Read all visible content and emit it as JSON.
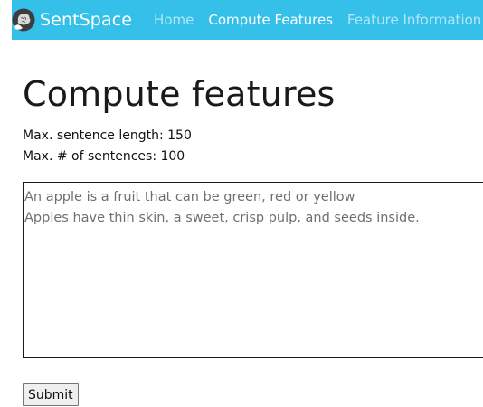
{
  "app": {
    "brand_name": "SentSpace",
    "brand_logo_icon": "brain-icon"
  },
  "navbar": {
    "background_color": "#35c0ea",
    "links": [
      {
        "label": "Home",
        "state": "inactive"
      },
      {
        "label": "Compute Features",
        "state": "active"
      },
      {
        "label": "Feature Information",
        "state": "inactive"
      }
    ]
  },
  "main": {
    "title": "Compute features",
    "max_sentence_length_text": "Max. sentence length: 150",
    "max_sentences_text": "Max. # of sentences: 100",
    "input": {
      "placeholder": "An apple is a fruit that can be green, red or yellow\nApples have thin skin, a sweet, crisp pulp, and seeds inside."
    },
    "submit_label": "Submit"
  }
}
